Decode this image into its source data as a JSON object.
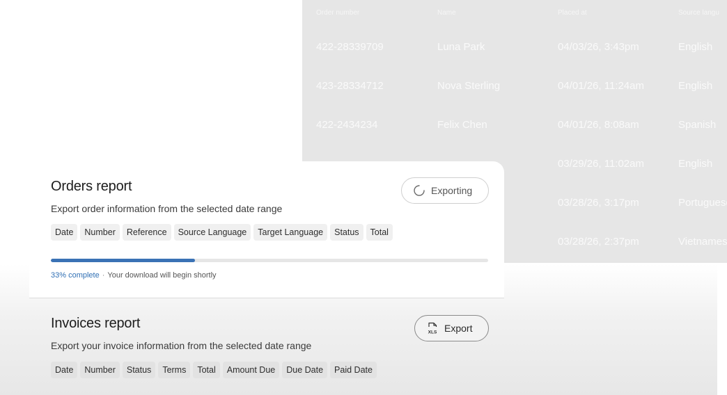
{
  "orders_table": {
    "headers": [
      "Order number",
      "Name",
      "Placed at",
      "Source langu"
    ],
    "rows": [
      [
        "422-28339709",
        "Luna Park",
        "04/03/26, 3:43pm",
        "English"
      ],
      [
        "423-28334712",
        "Nova Sterling",
        "04/01/26, 11:24am",
        "English"
      ],
      [
        "422-2434234",
        "Felix Chen",
        "04/01/26, 8:08am",
        "Spanish"
      ],
      [
        "",
        "",
        "03/29/26, 11:02am",
        "English"
      ],
      [
        "",
        "",
        "03/28/26, 3:17pm",
        "Portuguese"
      ],
      [
        "",
        "",
        "03/28/26, 2:37pm",
        "Vietnamese"
      ]
    ]
  },
  "orders_report": {
    "title": "Orders report",
    "subtitle": "Export order information from the selected date range",
    "button_label": "Exporting",
    "chips": [
      "Date",
      "Number",
      "Reference",
      "Source Language",
      "Target Language",
      "Status",
      "Total"
    ],
    "progress_fraction": 0.33,
    "progress_label": "33% complete",
    "progress_separator": "·",
    "progress_note": "Your download will begin shortly"
  },
  "invoices_report": {
    "title": "Invoices report",
    "subtitle": "Export your invoice information from the selected date range",
    "button_label": "Export",
    "chips": [
      "Date",
      "Number",
      "Status",
      "Terms",
      "Total",
      "Amount Due",
      "Due Date",
      "Paid Date"
    ]
  },
  "colors": {
    "accent": "#3a72b5",
    "table_bg": "#e6e6e6"
  },
  "icons": {
    "exporting": "spinner-icon",
    "export": "xls-file-icon"
  }
}
